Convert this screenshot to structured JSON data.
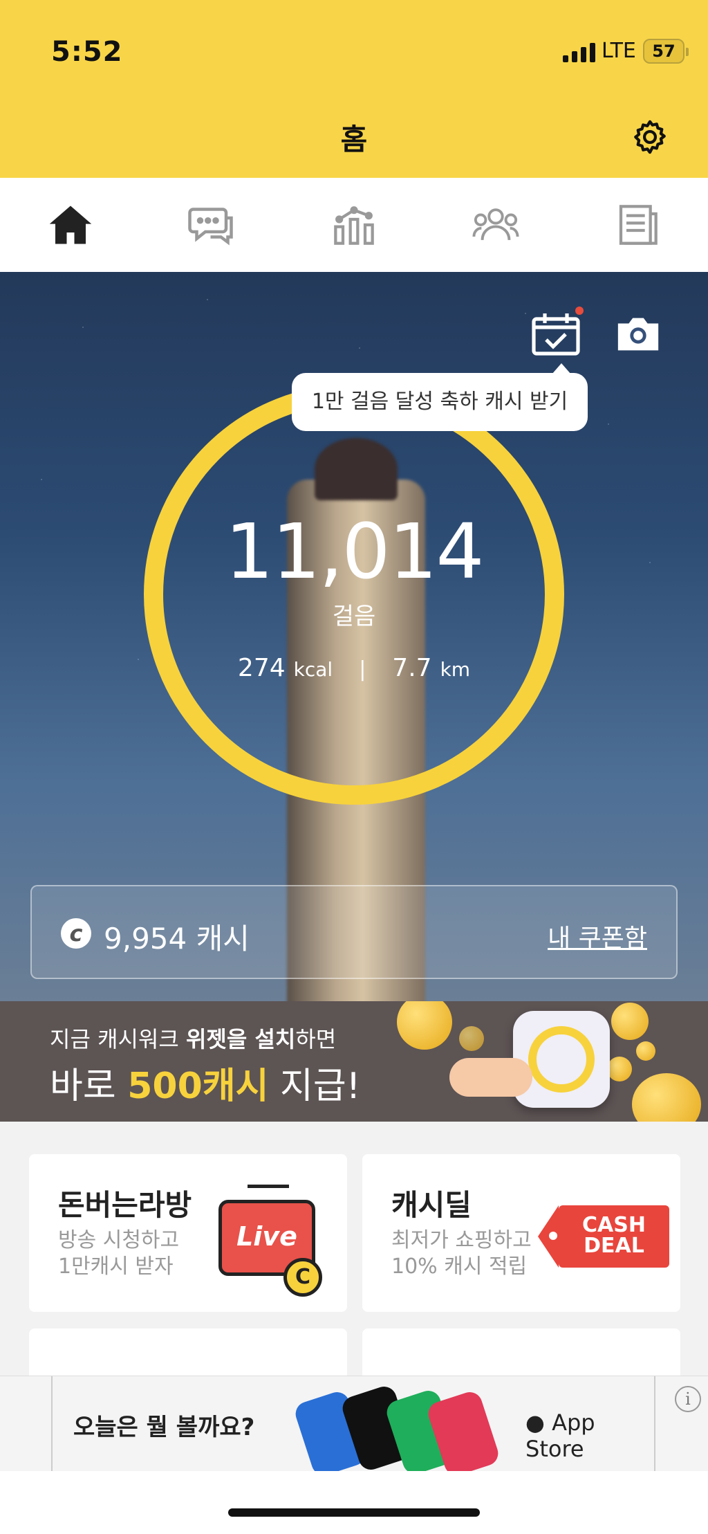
{
  "status_bar": {
    "time": "5:52",
    "network": "LTE",
    "battery": "57"
  },
  "header": {
    "title": "홈"
  },
  "tabs": [
    {
      "icon": "home-icon",
      "active": true
    },
    {
      "icon": "chat-icon",
      "active": false
    },
    {
      "icon": "ranking-icon",
      "active": false
    },
    {
      "icon": "group-icon",
      "active": false
    },
    {
      "icon": "news-icon",
      "active": false
    }
  ],
  "hero": {
    "tooltip": "1만 걸음 달성 축하 캐시 받기",
    "steps": "11,014",
    "steps_unit": "걸음",
    "kcal_value": "274",
    "kcal_unit": "kcal",
    "distance_value": "7.7",
    "distance_unit": "km",
    "cash_symbol": "c",
    "cash": "9,954 캐시",
    "coupon_link": "내 쿠폰함"
  },
  "banner": {
    "line1_pre": "지금 캐시워크 ",
    "line1_bold": "위젯을 설치",
    "line1_post": "하면",
    "line2_pre": "바로 ",
    "line2_highlight": "500캐시",
    "line2_post": " 지급!"
  },
  "cards": [
    {
      "title": "돈버는라방",
      "sub1": "방송 시청하고",
      "sub2": "1만캐시 받자",
      "badge": "Live",
      "coin": "C"
    },
    {
      "title": "캐시딜",
      "sub1": "최저가 쇼핑하고",
      "sub2": "10% 캐시 적립",
      "badge1": "CASH",
      "badge2": "DEAL"
    }
  ],
  "ad": {
    "text": "오늘은 뭘 볼까요?",
    "store": " App Store",
    "info": "i"
  },
  "colors": {
    "accent": "#f8d548",
    "banner_bg": "#5d5454",
    "highlight": "#f7d23c"
  }
}
